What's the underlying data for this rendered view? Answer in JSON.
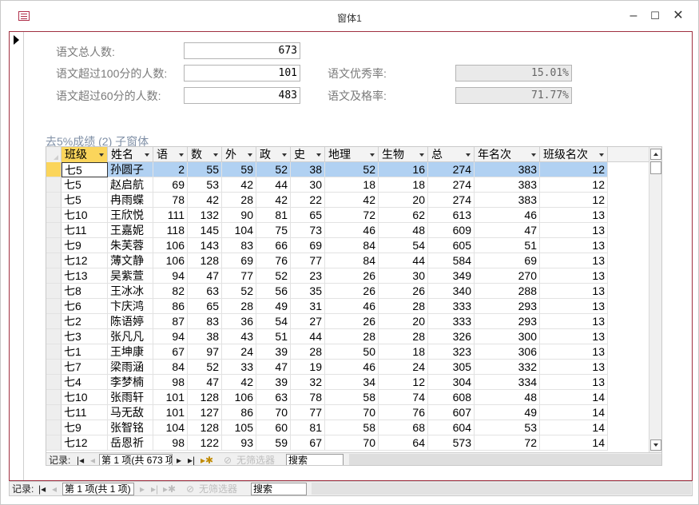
{
  "window": {
    "title": "窗体1",
    "minimize": "–",
    "maximize": "☐",
    "close": "✕"
  },
  "summary": {
    "total_label": "语文总人数:",
    "total_value": "673",
    "over100_label": "语文超过100分的人数:",
    "over100_value": "101",
    "over60_label": "语文超过60分的人数:",
    "over60_value": "483",
    "excellent_label": "语文优秀率:",
    "excellent_value": "15.01%",
    "pass_label": "语文及格率:",
    "pass_value": "71.77%"
  },
  "subform": {
    "label": "去5%成绩 (2) 子窗体",
    "columns": [
      "班级",
      "姓名",
      "语",
      "数",
      "外",
      "政",
      "史",
      "地理",
      "生物",
      "总",
      "年名次",
      "班级名次"
    ],
    "rows": [
      [
        "七5",
        "孙圆子",
        "2",
        "55",
        "59",
        "52",
        "38",
        "52",
        "16",
        "274",
        "383",
        "12"
      ],
      [
        "七5",
        "赵启航",
        "69",
        "53",
        "42",
        "44",
        "30",
        "18",
        "18",
        "274",
        "383",
        "12"
      ],
      [
        "七5",
        "冉雨蝶",
        "78",
        "42",
        "28",
        "42",
        "22",
        "42",
        "20",
        "274",
        "383",
        "12"
      ],
      [
        "七10",
        "王欣悦",
        "111",
        "132",
        "90",
        "81",
        "65",
        "72",
        "62",
        "613",
        "46",
        "13"
      ],
      [
        "七11",
        "王嘉妮",
        "118",
        "145",
        "104",
        "75",
        "73",
        "46",
        "48",
        "609",
        "47",
        "13"
      ],
      [
        "七9",
        "朱芙蓉",
        "106",
        "143",
        "83",
        "66",
        "69",
        "84",
        "54",
        "605",
        "51",
        "13"
      ],
      [
        "七12",
        "薄文静",
        "106",
        "128",
        "69",
        "76",
        "77",
        "84",
        "44",
        "584",
        "69",
        "13"
      ],
      [
        "七13",
        "吴紫萱",
        "94",
        "47",
        "77",
        "52",
        "23",
        "26",
        "30",
        "349",
        "270",
        "13"
      ],
      [
        "七8",
        "王冰冰",
        "82",
        "63",
        "52",
        "56",
        "35",
        "26",
        "26",
        "340",
        "288",
        "13"
      ],
      [
        "七6",
        "卞庆鸿",
        "86",
        "65",
        "28",
        "49",
        "31",
        "46",
        "28",
        "333",
        "293",
        "13"
      ],
      [
        "七2",
        "陈语婷",
        "87",
        "83",
        "36",
        "54",
        "27",
        "26",
        "20",
        "333",
        "293",
        "13"
      ],
      [
        "七3",
        "张凡凡",
        "94",
        "38",
        "43",
        "51",
        "44",
        "28",
        "28",
        "326",
        "300",
        "13"
      ],
      [
        "七1",
        "王坤康",
        "67",
        "97",
        "24",
        "39",
        "28",
        "50",
        "18",
        "323",
        "306",
        "13"
      ],
      [
        "七7",
        "梁雨涵",
        "84",
        "52",
        "33",
        "47",
        "19",
        "46",
        "24",
        "305",
        "332",
        "13"
      ],
      [
        "七4",
        "李梦楠",
        "98",
        "47",
        "42",
        "39",
        "32",
        "34",
        "12",
        "304",
        "334",
        "13"
      ],
      [
        "七10",
        "张雨轩",
        "101",
        "128",
        "106",
        "63",
        "78",
        "58",
        "74",
        "608",
        "48",
        "14"
      ],
      [
        "七11",
        "马无敌",
        "101",
        "127",
        "86",
        "70",
        "77",
        "70",
        "76",
        "607",
        "49",
        "14"
      ],
      [
        "七9",
        "张智铭",
        "104",
        "128",
        "105",
        "60",
        "81",
        "58",
        "68",
        "604",
        "53",
        "14"
      ],
      [
        "七12",
        "岳恩祈",
        "98",
        "122",
        "93",
        "59",
        "67",
        "70",
        "64",
        "573",
        "72",
        "14"
      ]
    ],
    "nav": {
      "label": "记录:",
      "first": "|◂",
      "prev": "◂",
      "position": "第 1 项(共 673 项",
      "next": "▸",
      "last": "▸|",
      "new": "▸✱",
      "filter": "无筛选器",
      "search": "搜索"
    }
  },
  "outer_nav": {
    "label": "记录:",
    "first": "|◂",
    "prev": "◂",
    "position": "第 1 项(共 1 项)",
    "next": "▸",
    "last": "▸|",
    "new": "▸✱",
    "filter": "无筛选器",
    "search": "搜索"
  }
}
